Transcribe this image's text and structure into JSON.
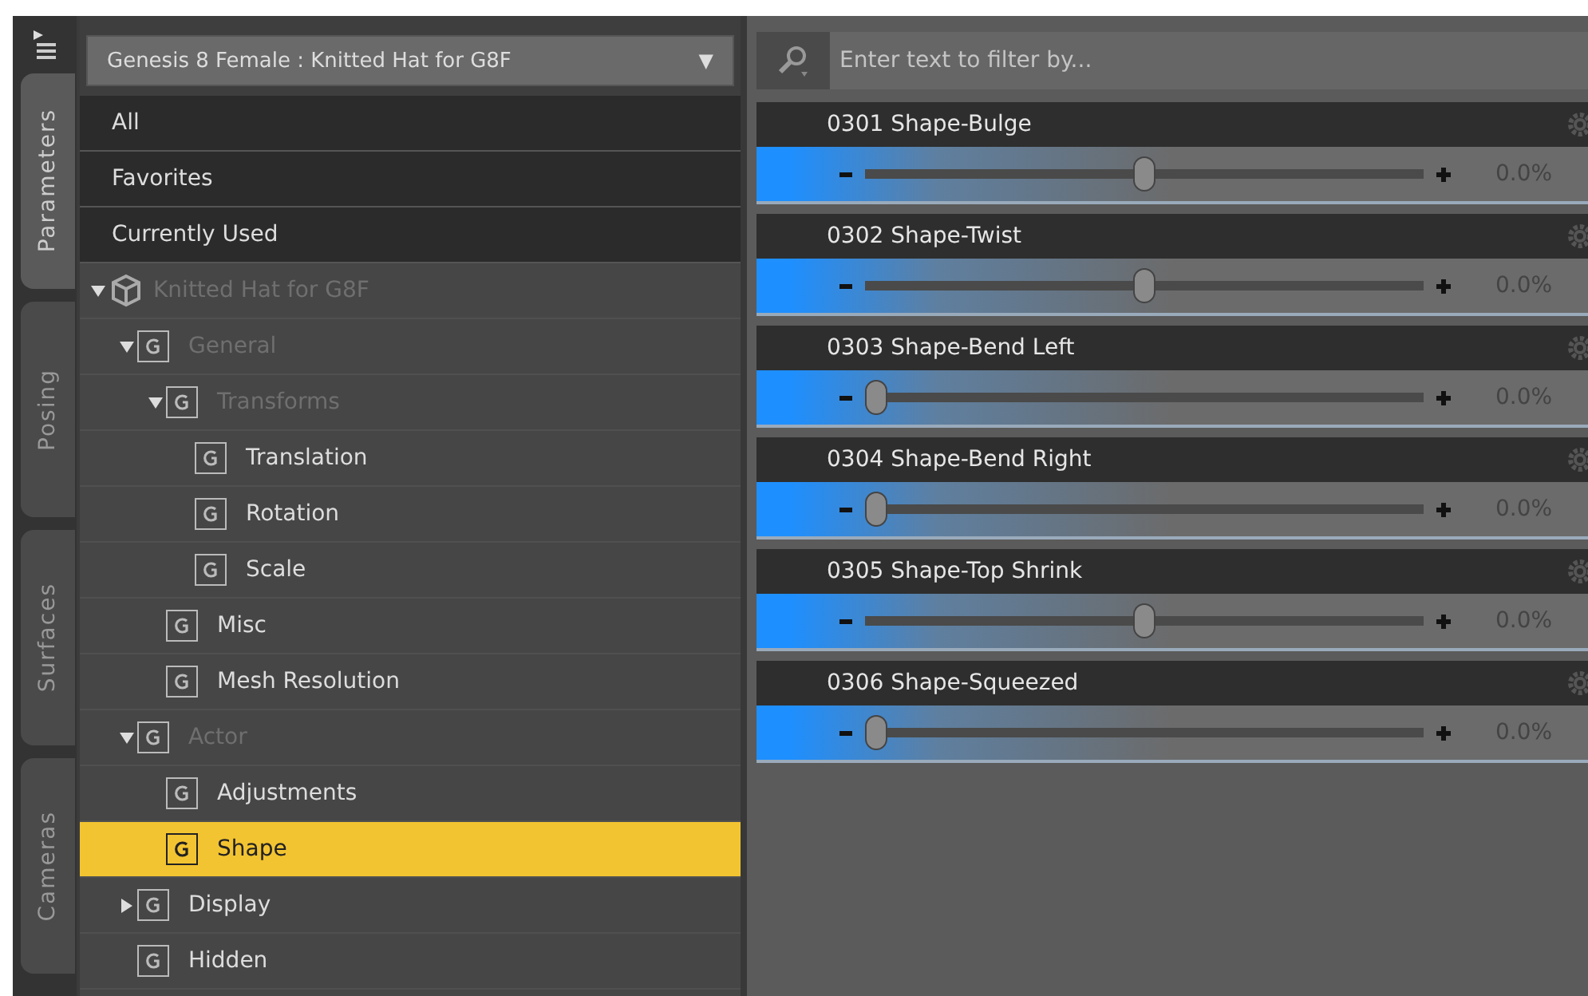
{
  "side_tabs": [
    {
      "label": "Parameters",
      "selected": true
    },
    {
      "label": "Posing",
      "selected": false
    },
    {
      "label": "Surfaces",
      "selected": false
    },
    {
      "label": "Cameras",
      "selected": false
    }
  ],
  "node_selector": {
    "value": "Genesis 8 Female : Knitted Hat for G8F",
    "arrow": "▼"
  },
  "filters": [
    {
      "label": "All"
    },
    {
      "label": "Favorites"
    },
    {
      "label": "Currently Used"
    }
  ],
  "tree": [
    {
      "label": "Knitted Hat for G8F",
      "kind": "figure",
      "dimmed": true,
      "expanded": true,
      "selected": false,
      "children": [
        {
          "label": "General",
          "kind": "group",
          "dimmed": true,
          "expanded": true,
          "selected": false,
          "children": [
            {
              "label": "Transforms",
              "kind": "group",
              "dimmed": true,
              "expanded": true,
              "selected": false,
              "children": [
                {
                  "label": "Translation",
                  "kind": "group",
                  "dimmed": false,
                  "selected": false
                },
                {
                  "label": "Rotation",
                  "kind": "group",
                  "dimmed": false,
                  "selected": false
                },
                {
                  "label": "Scale",
                  "kind": "group",
                  "dimmed": false,
                  "selected": false
                }
              ]
            },
            {
              "label": "Misc",
              "kind": "group",
              "dimmed": false,
              "selected": false
            },
            {
              "label": "Mesh Resolution",
              "kind": "group",
              "dimmed": false,
              "selected": false
            }
          ]
        },
        {
          "label": "Actor",
          "kind": "group",
          "dimmed": true,
          "expanded": true,
          "selected": false,
          "children": [
            {
              "label": "Adjustments",
              "kind": "group",
              "dimmed": false,
              "selected": false
            },
            {
              "label": "Shape",
              "kind": "group",
              "dimmed": false,
              "selected": true
            }
          ]
        },
        {
          "label": "Display",
          "kind": "group",
          "dimmed": false,
          "expanded": false,
          "selected": false
        },
        {
          "label": "Hidden",
          "kind": "group",
          "dimmed": false,
          "selected": false
        }
      ]
    }
  ],
  "filter_field": {
    "placeholder": "Enter text to filter by..."
  },
  "properties": [
    {
      "name": "0301 Shape-Bulge",
      "level": 0.5,
      "reading": "0.0%"
    },
    {
      "name": "0302 Shape-Twist",
      "level": 0.5,
      "reading": "0.0%"
    },
    {
      "name": "0303 Shape-Bend Left",
      "level": 0,
      "reading": "0.0%"
    },
    {
      "name": "0304 Shape-Bend Right",
      "level": 0,
      "reading": "0.0%"
    },
    {
      "name": "0305 Shape-Top Shrink",
      "level": 0.5,
      "reading": "0.0%"
    },
    {
      "name": "0306 Shape-Squeezed",
      "level": 0,
      "reading": "0.0%"
    }
  ]
}
